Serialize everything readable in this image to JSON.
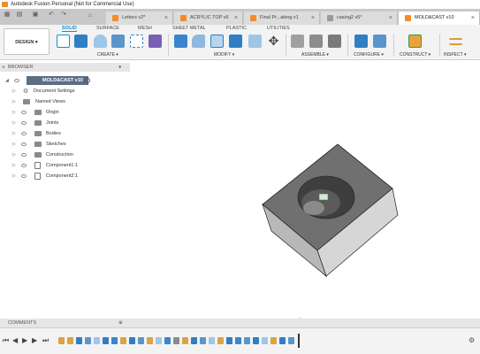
{
  "window": {
    "title": "Autodesk Fusion Personal (Not for Commercial Use)"
  },
  "tabs": [
    {
      "label": "Letters v2*",
      "active": false,
      "locked": false
    },
    {
      "label": "ACRYLIC TOP v6",
      "active": false,
      "locked": false
    },
    {
      "label": "Final Pr...aking v1",
      "active": false,
      "locked": false
    },
    {
      "label": "casing2 v5*",
      "active": false,
      "locked": true
    },
    {
      "label": "MOLD&CAST v10",
      "active": true,
      "locked": false
    }
  ],
  "toolbar": {
    "design_label": "DESIGN",
    "workspace_tabs": [
      "SOLID",
      "SURFACE",
      "MESH",
      "SHEET METAL",
      "PLASTIC",
      "UTILITIES"
    ],
    "groups": {
      "create": "CREATE",
      "modify": "MODIFY",
      "assemble": "ASSEMBLE",
      "configure": "CONFIGURE",
      "construct": "CONSTRUCT",
      "inspect": "INSPECT"
    }
  },
  "browser": {
    "title": "BROWSER",
    "root": "MOLD&CAST v10",
    "items": [
      "Document Settings",
      "Named Views",
      "Origin",
      "Joints",
      "Bodies",
      "Sketches",
      "Construction",
      "Component1:1",
      "Component2:1"
    ]
  },
  "comments": {
    "title": "COMMENTS"
  },
  "colors": {
    "accent": "#0696d7",
    "brand": "#f28c28",
    "body_top": "#707070",
    "body_front": "#b8b8b8",
    "body_side": "#d6d6d6"
  }
}
